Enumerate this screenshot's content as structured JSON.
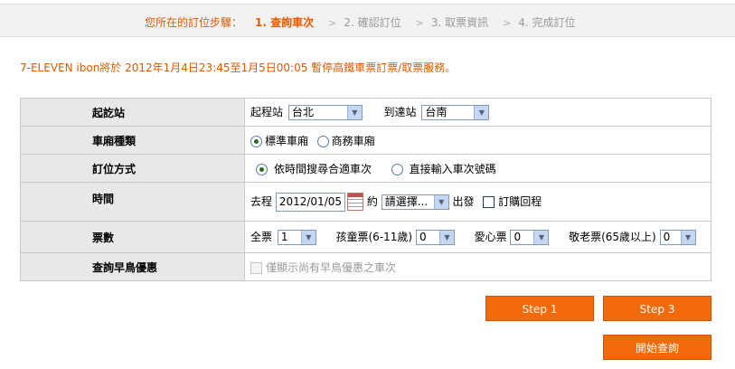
{
  "steps": {
    "prefix": "您所在的訂位步驟：",
    "items": [
      {
        "label": "1. 查詢車次",
        "active": true
      },
      {
        "label": "2. 確認訂位",
        "active": false
      },
      {
        "label": "3. 取票資訊",
        "active": false
      },
      {
        "label": "4. 完成訂位",
        "active": false
      }
    ],
    "separator": ">"
  },
  "notice": "7-ELEVEN ibon將於 2012年1月4日23:45至1月5日00:05 暫停高鐵車票訂票/取票服務。",
  "form": {
    "station": {
      "label": "起訖站",
      "from_label": "起程站",
      "from_value": "台北",
      "to_label": "到達站",
      "to_value": "台南"
    },
    "car_type": {
      "label": "車廂種類",
      "options": [
        {
          "label": "標準車廂",
          "selected": true
        },
        {
          "label": "商務車廂",
          "selected": false
        }
      ]
    },
    "booking_method": {
      "label": "訂位方式",
      "options": [
        {
          "label": "依時間搜尋合適車次",
          "selected": true
        },
        {
          "label": "直接輸入車次號碼",
          "selected": false
        }
      ]
    },
    "time": {
      "label": "時間",
      "outbound_label": "去程",
      "date_value": "2012/01/05",
      "approx_label": "約",
      "time_value": "請選擇...",
      "depart_label": "出發",
      "return_label": "訂購回程",
      "return_checked": false
    },
    "tickets": {
      "label": "票數",
      "full": {
        "label": "全票",
        "value": "1"
      },
      "child": {
        "label": "孩童票(6-11歲)",
        "value": "0"
      },
      "disabled": {
        "label": "愛心票",
        "value": "0"
      },
      "senior": {
        "label": "敬老票(65歲以上)",
        "value": "0"
      }
    },
    "early_bird": {
      "label": "查詢早鳥優惠",
      "checkbox_label": "僅顯示尚有早鳥優惠之車次",
      "checked": false,
      "disabled": true
    }
  },
  "buttons": {
    "step1": "Step 1",
    "step3": "Step 3",
    "search": "開始查詢"
  },
  "colors": {
    "accent": "#e05a00",
    "button": "#f26a0a",
    "label_bg": "#e8e8e8"
  }
}
